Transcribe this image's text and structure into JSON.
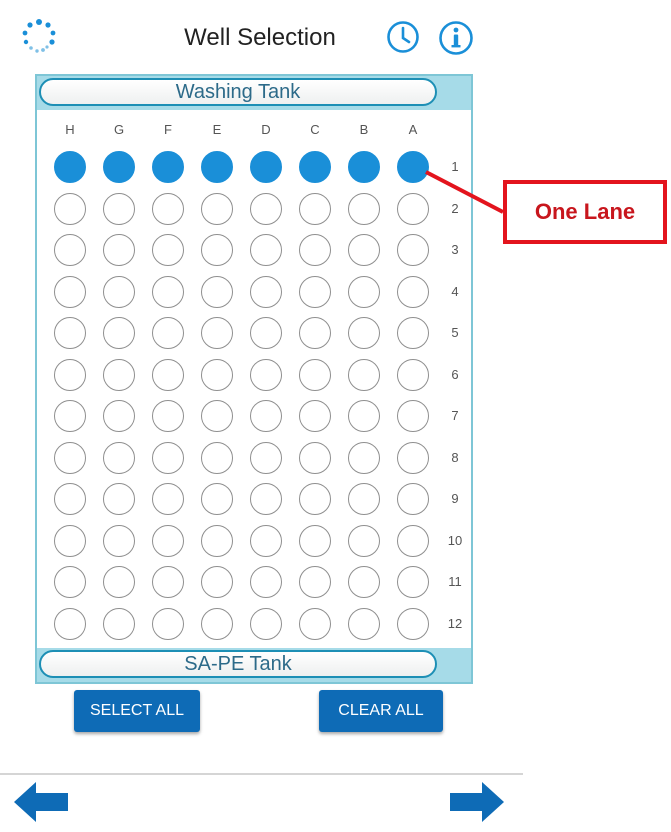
{
  "header": {
    "title": "Well Selection"
  },
  "icons": {
    "logo": "app-logo-icon",
    "history": "clock-icon",
    "info": "info-icon"
  },
  "plate": {
    "top_tank": "Washing Tank",
    "bottom_tank": "SA-PE Tank",
    "columns": [
      "H",
      "G",
      "F",
      "E",
      "D",
      "C",
      "B",
      "A"
    ],
    "rows": [
      "1",
      "2",
      "3",
      "4",
      "5",
      "6",
      "7",
      "8",
      "9",
      "10",
      "11",
      "12"
    ],
    "selected_rows": [
      "1"
    ]
  },
  "buttons": {
    "select_all": "SELECT ALL",
    "clear_all": "CLEAR ALL"
  },
  "nav": {
    "back": "arrow-left-icon",
    "next": "arrow-right-icon"
  },
  "annotation": {
    "label": "One Lane"
  },
  "colors": {
    "accent": "#1a8fd8",
    "button": "#0e6bb6",
    "tank_bar": "#a6dbe8",
    "callout": "#e3141d"
  }
}
